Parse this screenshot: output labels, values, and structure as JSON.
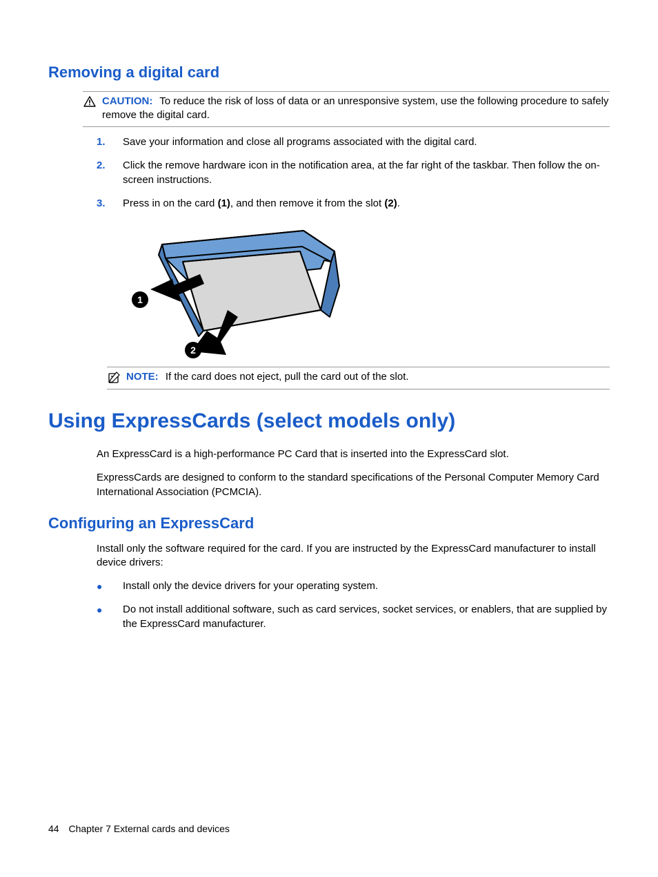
{
  "section1": {
    "heading": "Removing a digital card",
    "caution": {
      "label": "CAUTION:",
      "text": "To reduce the risk of loss of data or an unresponsive system, use the following procedure to safely remove the digital card."
    },
    "steps": [
      {
        "num": "1.",
        "text": "Save your information and close all programs associated with the digital card."
      },
      {
        "num": "2.",
        "text": "Click the remove hardware icon in the notification area, at the far right of the taskbar. Then follow the on-screen instructions."
      },
      {
        "num": "3.",
        "prefix": "Press in on the card ",
        "b1": "(1)",
        "mid": ", and then remove it from the slot ",
        "b2": "(2)",
        "suffix": "."
      }
    ],
    "note": {
      "label": "NOTE:",
      "text": "If the card does not eject, pull the card out of the slot."
    }
  },
  "section2": {
    "heading": "Using ExpressCards (select models only)",
    "p1": "An ExpressCard is a high-performance PC Card that is inserted into the ExpressCard slot.",
    "p2": "ExpressCards are designed to conform to the standard specifications of the Personal Computer Memory Card International Association (PCMCIA)."
  },
  "section3": {
    "heading": "Configuring an ExpressCard",
    "p1": "Install only the software required for the card. If you are instructed by the ExpressCard manufacturer to install device drivers:",
    "bullets": [
      "Install only the device drivers for your operating system.",
      "Do not install additional software, such as card services, socket services, or enablers, that are supplied by the ExpressCard manufacturer."
    ]
  },
  "footer": {
    "page": "44",
    "chapter": "Chapter 7   External cards and devices"
  }
}
